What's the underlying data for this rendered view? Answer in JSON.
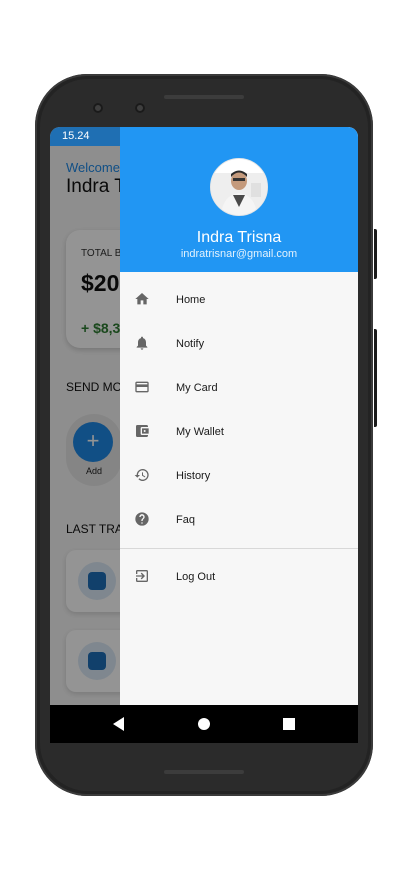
{
  "status_bar": {
    "time": "15.24"
  },
  "app": {
    "welcome": "Welcome",
    "user_short": "Indra T",
    "total_label": "TOTAL B",
    "balance": "$20",
    "change": "+ $8,3",
    "send_section": "SEND MO",
    "add_label": "Add",
    "last_section": "LAST TRA"
  },
  "drawer": {
    "name": "Indra Trisna",
    "email": "indratrisnar@gmail.com",
    "items": [
      {
        "label": "Home",
        "icon": "home-icon"
      },
      {
        "label": "Notify",
        "icon": "bell-icon"
      },
      {
        "label": "My Card",
        "icon": "credit-card-icon"
      },
      {
        "label": "My Wallet",
        "icon": "wallet-icon"
      },
      {
        "label": "History",
        "icon": "history-icon"
      },
      {
        "label": "Faq",
        "icon": "help-icon"
      }
    ],
    "logout_label": "Log Out"
  },
  "colors": {
    "accent": "#2196f3",
    "positive": "#2e7d32"
  }
}
